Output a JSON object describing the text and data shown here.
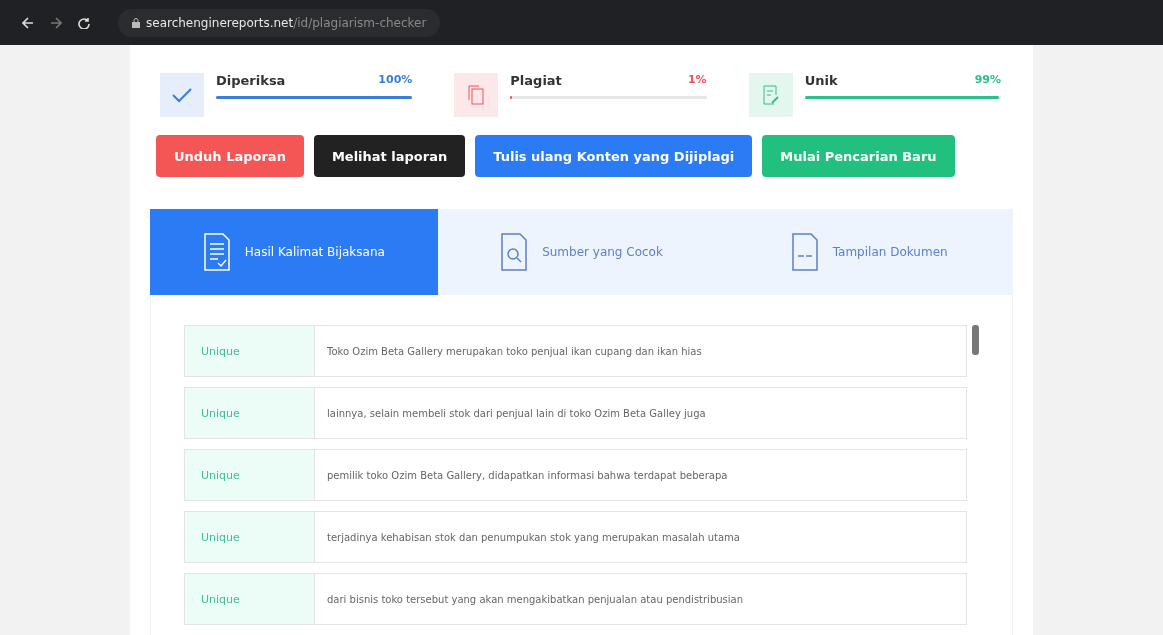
{
  "browser": {
    "url_host": "searchenginereports.net",
    "url_path": "/id/plagiarism-checker"
  },
  "stats": [
    {
      "kind": "checked",
      "label": "Diperiksa",
      "percent": "100%",
      "level": 1,
      "color": "#3b7ddd"
    },
    {
      "kind": "plagiarism",
      "label": "Plagiat",
      "percent": "1%",
      "level": 0.01,
      "color": "#f0505a"
    },
    {
      "kind": "unique",
      "label": "Unik",
      "percent": "99%",
      "level": 0.99,
      "color": "#2ec08a"
    }
  ],
  "buttons": [
    {
      "label": "Unduh Laporan",
      "color": "#f45656"
    },
    {
      "label": "Melihat laporan",
      "color": "#222222"
    },
    {
      "label": "Tulis ulang Konten yang Dijiplagi",
      "color": "#2a7bf4"
    },
    {
      "label": "Mulai Pencarian Baru",
      "color": "#22c07e"
    }
  ],
  "tabs": [
    {
      "kind": "sentences",
      "label": "Hasil Kalimat Bijaksana",
      "selected": true
    },
    {
      "kind": "sources",
      "label": "Sumber yang Cocok",
      "selected": false
    },
    {
      "kind": "document",
      "label": "Tampilan Dokumen",
      "selected": false
    }
  ],
  "results": [
    {
      "status": "Unique",
      "text": "Toko Ozim Beta Gallery merupakan toko penjual ikan cupang dan ikan hias"
    },
    {
      "status": "Unique",
      "text": "lainnya, selain membeli stok dari penjual lain di toko Ozim Beta Galley juga"
    },
    {
      "status": "Unique",
      "text": "pemilik toko Ozim Beta Gallery, didapatkan informasi bahwa terdapat beberapa"
    },
    {
      "status": "Unique",
      "text": "terjadinya kehabisan stok dan penumpukan stok yang merupakan masalah utama"
    },
    {
      "status": "Unique",
      "text": "dari bisnis toko tersebut yang akan mengakibatkan penjualan atau pendistribusian"
    }
  ]
}
